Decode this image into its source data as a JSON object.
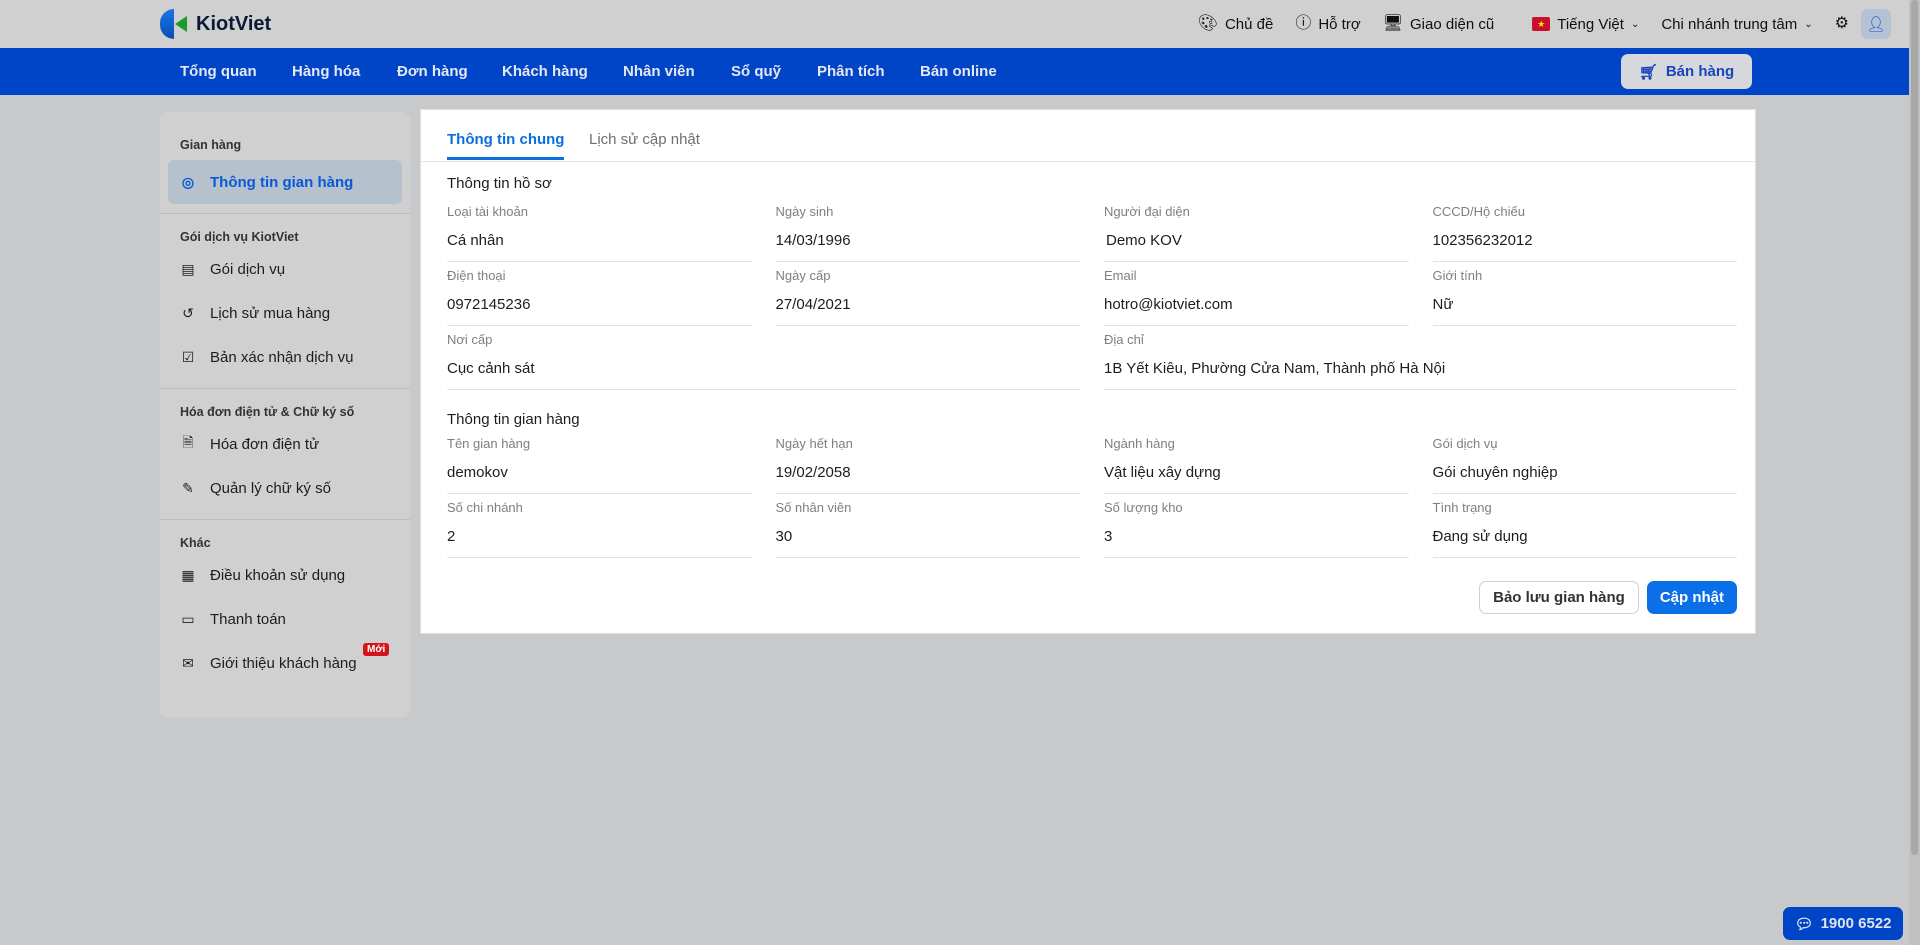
{
  "header": {
    "brand": "KiotViet",
    "tools": [
      {
        "icon": "palette-icon",
        "label": "Chủ đề"
      },
      {
        "icon": "support-icon",
        "label": "Hỗ trợ"
      },
      {
        "icon": "monitor-icon",
        "label": "Giao diện cũ"
      }
    ],
    "language": "Tiếng Việt",
    "branch": "Chi nhánh trung tâm"
  },
  "nav": {
    "items": [
      "Tổng quan",
      "Hàng hóa",
      "Đơn hàng",
      "Khách hàng",
      "Nhân viên",
      "Sổ quỹ",
      "Phân tích",
      "Bán online"
    ],
    "sell_label": "Bán hàng"
  },
  "sidebar": {
    "sections": [
      {
        "title": "Gian hàng",
        "items": [
          {
            "label": "Thông tin gian hàng",
            "icon": "user-circle-icon",
            "active": true
          }
        ]
      },
      {
        "title": "Gói dịch vụ KiotViet",
        "items": [
          {
            "label": "Gói dịch vụ",
            "icon": "store-icon"
          },
          {
            "label": "Lịch sử mua hàng",
            "icon": "history-icon"
          },
          {
            "label": "Bản xác nhận dịch vụ",
            "icon": "doc-check-icon"
          }
        ]
      },
      {
        "title": "Hóa đơn điện tử & Chữ ký số",
        "items": [
          {
            "label": "Hóa đơn điện tử",
            "icon": "invoice-icon"
          },
          {
            "label": "Quản lý chữ ký số",
            "icon": "signature-icon"
          }
        ]
      },
      {
        "title": "Khác",
        "items": [
          {
            "label": "Điều khoản sử dụng",
            "icon": "terms-icon"
          },
          {
            "label": "Thanh toán",
            "icon": "wallet-icon"
          },
          {
            "label": "Giới thiệu khách hàng",
            "icon": "mail-icon",
            "badge": "Mới"
          }
        ]
      }
    ]
  },
  "main": {
    "tabs": [
      "Thông tin chung",
      "Lịch sử cập nhật"
    ],
    "profile": {
      "title": "Thông tin hồ sơ",
      "fields": [
        {
          "label": "Loại tài khoản",
          "value": "Cá nhân"
        },
        {
          "label": "Ngày sinh",
          "value": "14/03/1996"
        },
        {
          "label": "Người đại diện",
          "value": "Demo KOV"
        },
        {
          "label": "CCCD/Hộ chiếu",
          "value": "102356232012"
        },
        {
          "label": "Điện thoại",
          "value": "0972145236"
        },
        {
          "label": "Ngày cấp",
          "value": "27/04/2021"
        },
        {
          "label": "Email",
          "value": "hotro@kiotviet.com"
        },
        {
          "label": "Giới tính",
          "value": "Nữ"
        },
        {
          "label": "Nơi cấp",
          "value": "Cục cảnh sát",
          "wide": true
        },
        {
          "label": "Địa chỉ",
          "value": "1B Yết Kiêu, Phường Cửa Nam, Thành phố Hà Nội",
          "wide": true
        }
      ]
    },
    "store": {
      "title": "Thông tin gian hàng",
      "fields": [
        {
          "label": "Tên gian hàng",
          "value": "demokov"
        },
        {
          "label": "Ngày hết hạn",
          "value": "19/02/2058"
        },
        {
          "label": "Ngành hàng",
          "value": "Vật liệu xây dựng"
        },
        {
          "label": "Gói dịch vụ",
          "value": "Gói chuyên nghiệp"
        },
        {
          "label": "Số chi nhánh",
          "value": "2"
        },
        {
          "label": "Số nhân viên",
          "value": "30"
        },
        {
          "label": "Số lượng kho",
          "value": "3"
        },
        {
          "label": "Tình trạng",
          "value": "Đang sử dụng"
        }
      ]
    },
    "buttons": {
      "backup": "Bảo lưu gian hàng",
      "update": "Cập nhật"
    }
  },
  "hotline": "1900 6522",
  "colors": {
    "primary": "#0045c8",
    "accent": "#0b6fe8",
    "badge": "#d4131a"
  }
}
